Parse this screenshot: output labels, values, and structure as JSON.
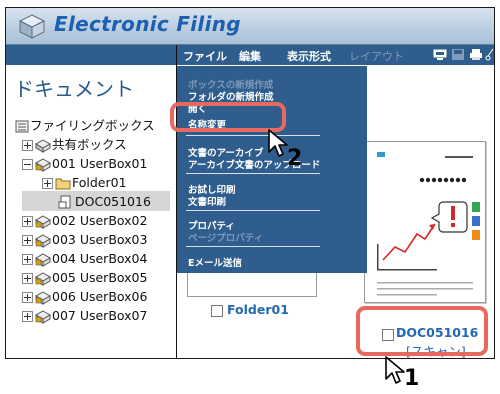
{
  "app": {
    "title": "Electronic Filing",
    "logo_icon": "globe-cube-icon"
  },
  "left": {
    "heading": "ドキュメント",
    "tree": [
      {
        "label": "ファイリングボックス",
        "icon": "filing-box-icon",
        "expander": "none"
      },
      {
        "label": "共有ボックス",
        "icon": "shared-box-icon",
        "expander": "plus"
      },
      {
        "label": "001 UserBox01",
        "icon": "userbox-icon",
        "expander": "minus",
        "selected": true
      },
      {
        "label": "Folder01",
        "icon": "folder-icon",
        "expander": "plus"
      },
      {
        "label": "DOC051016",
        "icon": "document-icon",
        "expander": "none"
      },
      {
        "label": "002 UserBox02",
        "icon": "userbox-icon",
        "expander": "plus"
      },
      {
        "label": "003 UserBox03",
        "icon": "userbox-icon",
        "expander": "plus"
      },
      {
        "label": "004 UserBox04",
        "icon": "userbox-icon",
        "expander": "plus"
      },
      {
        "label": "005 UserBox05",
        "icon": "userbox-icon",
        "expander": "plus"
      },
      {
        "label": "006 UserBox06",
        "icon": "userbox-icon",
        "expander": "plus"
      },
      {
        "label": "007 UserBox07",
        "icon": "userbox-icon",
        "expander": "plus"
      }
    ]
  },
  "toolbar": {
    "file": "ファイル",
    "edit": "編集",
    "view": "表示形式",
    "layout": "レイアウト",
    "icons": [
      "preview-icon",
      "save-icon",
      "print-icon",
      "cut-icon"
    ]
  },
  "menu": {
    "items": [
      {
        "label": "ボックスの新規作成",
        "enabled": false
      },
      {
        "label": "フォルダの新規作成",
        "enabled": true
      },
      {
        "label": "開く",
        "enabled": true
      },
      {
        "label": "名称変更",
        "enabled": true,
        "highlighted": true
      },
      {
        "label": "文書のアーカイブ",
        "enabled": true
      },
      {
        "label": "アーカイブ文書のアップロード",
        "enabled": true
      },
      {
        "label": "お試し印刷",
        "enabled": true
      },
      {
        "label": "文書印刷",
        "enabled": true
      },
      {
        "label": "プロパティ",
        "enabled": true
      },
      {
        "label": "ページプロパティ",
        "enabled": false
      },
      {
        "label": "Eメール送信",
        "enabled": true
      }
    ]
  },
  "content": {
    "folder_label": "Folder01",
    "doc_label": "DOC051016",
    "doc_sub": "[スキャン]"
  },
  "annotations": {
    "step1": "1",
    "step2": "2",
    "highlight_color": "#e86a5f"
  }
}
